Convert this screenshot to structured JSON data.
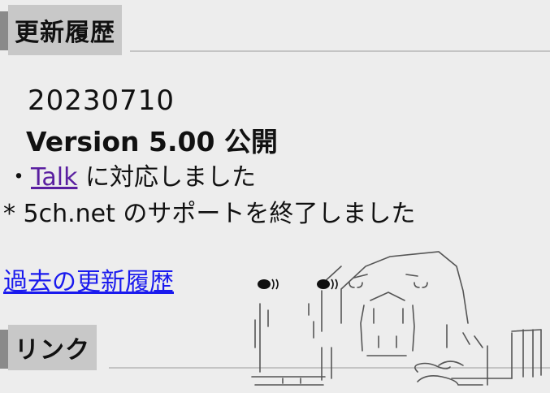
{
  "history": {
    "title": "更新履歴",
    "date": "20230710",
    "version": "Version 5.00 公開",
    "line1_prefix": "・",
    "line1_link": "Talk",
    "line1_suffix": " に対応しました",
    "line2": "* 5ch.net のサポートを終了しました",
    "past_link": "過去の更新履歴"
  },
  "links": {
    "title": "リンク"
  },
  "icons": {
    "art": "ascii-art-character"
  },
  "colors": {
    "background": "#ededed",
    "header_box": "#c8c8c8",
    "header_bar": "#8a8a8a",
    "visited_link": "#5a1fa0",
    "link": "#1a1aee"
  }
}
